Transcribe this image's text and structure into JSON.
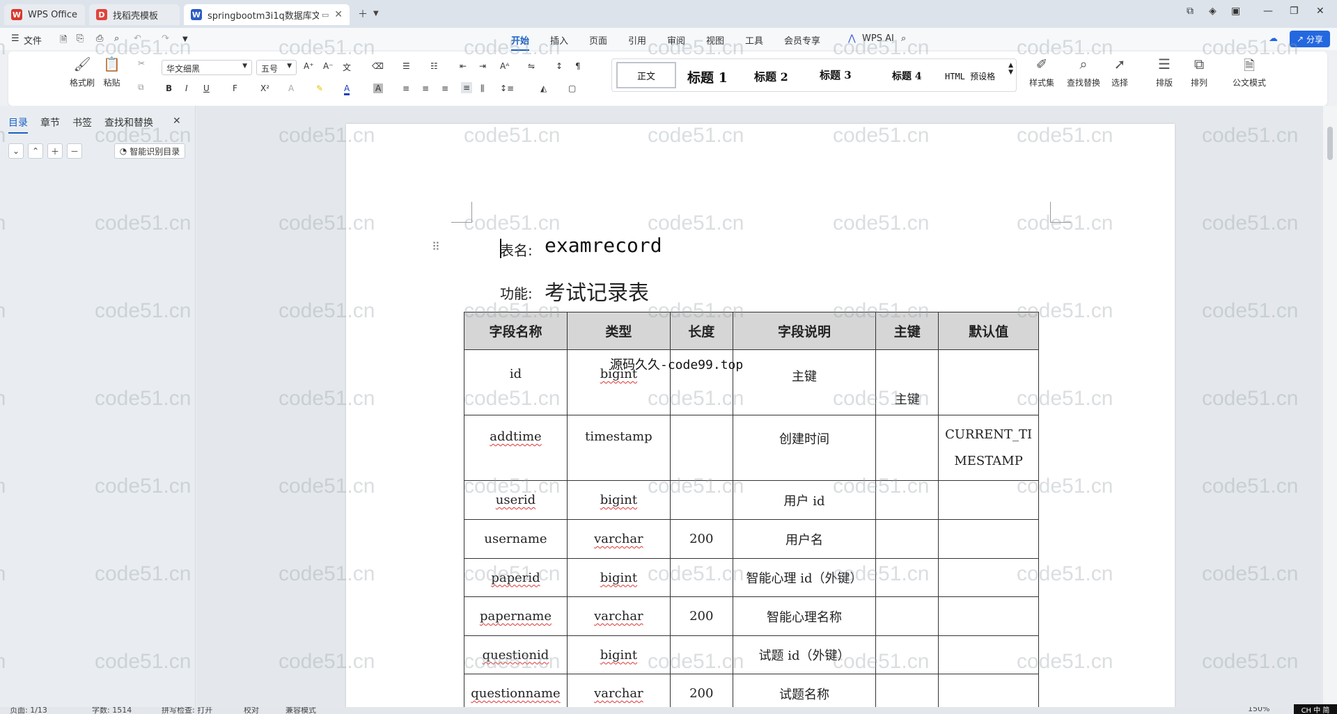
{
  "tabs": [
    {
      "label": "WPS Office",
      "icon": "wps-logo-icon",
      "color": "#d8382b"
    },
    {
      "label": "找稻壳模板",
      "icon": "docer-icon",
      "color": "#e0443a"
    },
    {
      "label": "springbootm3i1q数据库文",
      "icon": "word-doc-icon",
      "color": "#2b5cc4"
    }
  ],
  "menubar": {
    "file": "文件",
    "items": [
      "开始",
      "插入",
      "页面",
      "引用",
      "审阅",
      "视图",
      "工具",
      "会员专享"
    ],
    "active": "开始",
    "ai": "WPS AI",
    "share": "分享"
  },
  "ribbon": {
    "format_painter": "格式刷",
    "paste": "粘贴",
    "font_name": "华文细黑",
    "font_size": "五号",
    "styles": {
      "normal": "正文",
      "h1": "标题 1",
      "h2": "标题 2",
      "h3": "标题 3",
      "h4": "标题 4",
      "html": "HTML 预设格"
    },
    "style_set": "样式集",
    "find_replace": "查找替换",
    "select": "选择",
    "layout": "排版",
    "arrange": "排列",
    "official": "公文模式"
  },
  "left_panel": {
    "tabs": [
      "目录",
      "章节",
      "书签",
      "查找和替换"
    ],
    "smart": "智能识别目录"
  },
  "document": {
    "table_label": "表名:",
    "table_name": "examrecord",
    "function_label": "功能:",
    "function_value": "考试记录表",
    "overlay": "源码久久-code99.top",
    "headers": [
      "字段名称",
      "类型",
      "长度",
      "字段说明",
      "主键",
      "默认值"
    ],
    "rows": [
      {
        "name": "id",
        "type": "bigint",
        "length": "",
        "desc": "主键",
        "pk": "主键",
        "default": ""
      },
      {
        "name": "addtime",
        "type": "timestamp",
        "length": "",
        "desc": "创建时间",
        "pk": "",
        "default": "CURRENT_TIMESTAMP"
      },
      {
        "name": "userid",
        "type": "bigint",
        "length": "",
        "desc": "用户 id",
        "pk": "",
        "default": ""
      },
      {
        "name": "username",
        "type": "varchar",
        "length": "200",
        "desc": "用户名",
        "pk": "",
        "default": ""
      },
      {
        "name": "paperid",
        "type": "bigint",
        "length": "",
        "desc": "智能心理 id（外键）",
        "pk": "",
        "default": ""
      },
      {
        "name": "papername",
        "type": "varchar",
        "length": "200",
        "desc": "智能心理名称",
        "pk": "",
        "default": ""
      },
      {
        "name": "questionid",
        "type": "bigint",
        "length": "",
        "desc": "试题 id（外键）",
        "pk": "",
        "default": ""
      },
      {
        "name": "questionname",
        "type": "varchar",
        "length": "200",
        "desc": "试题名称",
        "pk": "",
        "default": ""
      }
    ]
  },
  "watermark": "code51.cn",
  "status": {
    "page": "页面: 1/13",
    "words": "字数: 1514",
    "spell": "拼写检查: 打开",
    "proof": "校对",
    "compat": "兼容模式",
    "zoom": "150%",
    "lang": "CH 中 简"
  }
}
